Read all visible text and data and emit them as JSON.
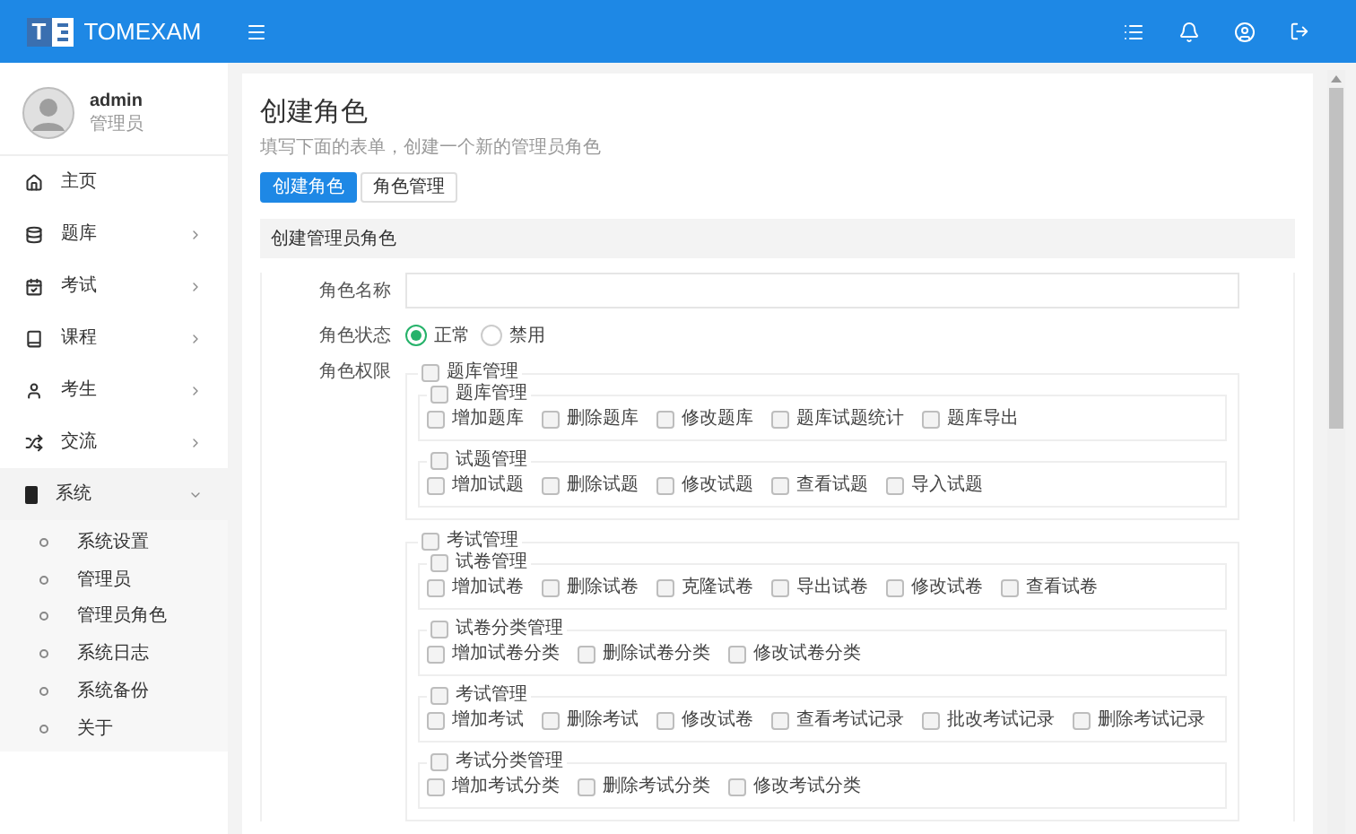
{
  "topbar": {
    "logo_letter": "T",
    "brand": "TOMEXAM"
  },
  "user": {
    "name": "admin",
    "role": "管理员"
  },
  "sidebar": {
    "items": [
      {
        "label": "主页"
      },
      {
        "label": "题库",
        "expanded": false
      },
      {
        "label": "考试",
        "expanded": false
      },
      {
        "label": "课程",
        "expanded": false
      },
      {
        "label": "考生",
        "expanded": false
      },
      {
        "label": "交流",
        "expanded": false
      },
      {
        "label": "系统",
        "expanded": true,
        "children": [
          {
            "label": "系统设置"
          },
          {
            "label": "管理员"
          },
          {
            "label": "管理员角色"
          },
          {
            "label": "系统日志"
          },
          {
            "label": "系统备份"
          },
          {
            "label": "关于"
          }
        ]
      }
    ]
  },
  "page": {
    "title": "创建角色",
    "subtitle": "填写下面的表单，创建一个新的管理员角色"
  },
  "tabs": [
    {
      "label": "创建角色",
      "selected": true
    },
    {
      "label": "角色管理",
      "selected": false
    }
  ],
  "form": {
    "section_title": "创建管理员角色",
    "name_label": "角色名称",
    "status_label": "角色状态",
    "status_options": [
      {
        "label": "正常",
        "selected": true
      },
      {
        "label": "禁用",
        "selected": false
      }
    ],
    "permissions_label": "角色权限",
    "permissions": [
      {
        "label": "题库管理",
        "checked": false,
        "children": [
          {
            "label": "题库管理",
            "checked": false,
            "children": [
              {
                "label": "增加题库",
                "checked": false
              },
              {
                "label": "删除题库",
                "checked": false
              },
              {
                "label": "修改题库",
                "checked": false
              },
              {
                "label": "题库试题统计",
                "checked": false
              },
              {
                "label": "题库导出",
                "checked": false
              }
            ]
          },
          {
            "label": "试题管理",
            "checked": false,
            "children": [
              {
                "label": "增加试题",
                "checked": false
              },
              {
                "label": "删除试题",
                "checked": false
              },
              {
                "label": "修改试题",
                "checked": false
              },
              {
                "label": "查看试题",
                "checked": false
              },
              {
                "label": "导入试题",
                "checked": false
              }
            ]
          }
        ]
      },
      {
        "label": "考试管理",
        "checked": false,
        "children": [
          {
            "label": "试卷管理",
            "checked": false,
            "children": [
              {
                "label": "增加试卷",
                "checked": false
              },
              {
                "label": "删除试卷",
                "checked": false
              },
              {
                "label": "克隆试卷",
                "checked": false
              },
              {
                "label": "导出试卷",
                "checked": false
              },
              {
                "label": "修改试卷",
                "checked": false
              },
              {
                "label": "查看试卷",
                "checked": false
              }
            ]
          },
          {
            "label": "试卷分类管理",
            "checked": false,
            "children": [
              {
                "label": "增加试卷分类",
                "checked": false
              },
              {
                "label": "删除试卷分类",
                "checked": false
              },
              {
                "label": "修改试卷分类",
                "checked": false
              }
            ]
          },
          {
            "label": "考试管理",
            "checked": false,
            "children": [
              {
                "label": "增加考试",
                "checked": false
              },
              {
                "label": "删除考试",
                "checked": false
              },
              {
                "label": "修改试卷",
                "checked": false
              },
              {
                "label": "查看考试记录",
                "checked": false
              },
              {
                "label": "批改考试记录",
                "checked": false
              },
              {
                "label": "删除考试记录",
                "checked": false
              }
            ]
          },
          {
            "label": "考试分类管理",
            "checked": false,
            "children": [
              {
                "label": "增加考试分类",
                "checked": false
              },
              {
                "label": "删除考试分类",
                "checked": false
              },
              {
                "label": "修改考试分类",
                "checked": false
              }
            ]
          }
        ]
      }
    ]
  }
}
